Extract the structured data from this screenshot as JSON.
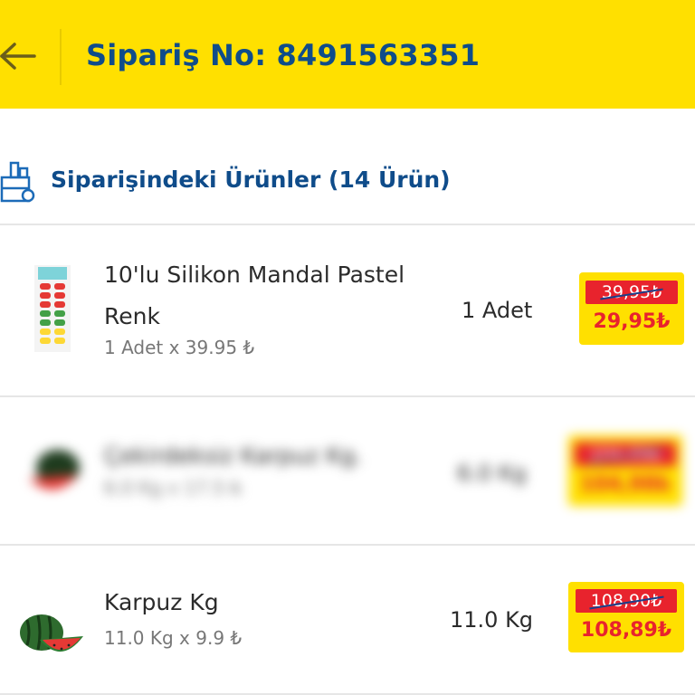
{
  "header": {
    "title": "Sipariş No: 8491563351",
    "back_icon": "arrow-left-icon",
    "background": "#FFE000",
    "title_color": "#0F4C8A"
  },
  "section": {
    "title": "Siparişindeki Ürünler (14 Ürün)",
    "icon": "shopping-bag-icon"
  },
  "items": [
    {
      "name": "10'lu Silikon Mandal Pastel Renk",
      "unit_line": "1 Adet x 39.95 ₺",
      "quantity": "1 Adet",
      "old_price": "39,95₺",
      "new_price": "29,95₺",
      "image": "clothespin-pack-image"
    },
    {
      "name": "Çekirdeksiz Karpuz Kg.",
      "unit_line": "6.0 Kg x 17.5 ₺",
      "quantity": "6.0 Kg",
      "old_price": "104,99₺",
      "new_price": "104,98₺",
      "image": "watermelon-image",
      "blurred": true
    },
    {
      "name": "Karpuz Kg",
      "unit_line": "11.0 Kg x 9.9 ₺",
      "quantity": "11.0 Kg",
      "old_price": "108,90₺",
      "new_price": "108,89₺",
      "image": "watermelon-image"
    }
  ],
  "colors": {
    "accent_yellow": "#FFE000",
    "discount_red": "#E8232D",
    "brand_blue": "#0F4C8A"
  }
}
